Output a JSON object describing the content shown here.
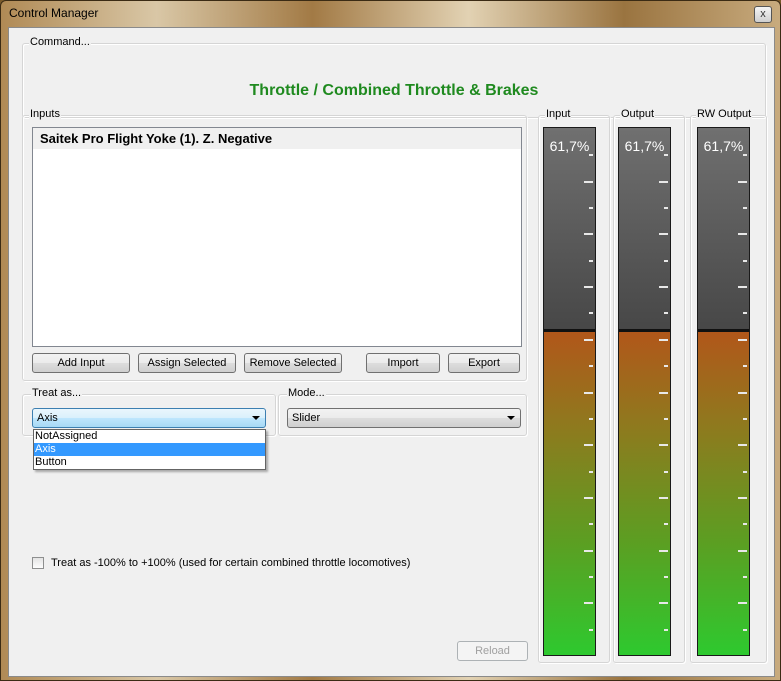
{
  "window": {
    "title": "Control Manager",
    "close_glyph": "x"
  },
  "command": {
    "label": "Command...",
    "text": "Throttle / Combined Throttle & Brakes"
  },
  "inputs": {
    "label": "Inputs",
    "items": [
      "Saitek Pro Flight Yoke (1). Z. Negative"
    ]
  },
  "buttons": {
    "add_input": "Add Input",
    "assign_selected": "Assign Selected",
    "remove_selected": "Remove Selected",
    "import": "Import",
    "export": "Export",
    "reload": "Reload"
  },
  "treat_as": {
    "label": "Treat as...",
    "value": "Axis",
    "options": [
      "NotAssigned",
      "Axis",
      "Button"
    ],
    "selected_index": 1
  },
  "mode": {
    "label": "Mode...",
    "value": "Slider"
  },
  "checkbox": {
    "label": "Treat as -100% to +100% (used for certain combined throttle locomotives)",
    "checked": false
  },
  "meters": [
    {
      "label": "Input",
      "value_text": "61,7%",
      "level": 0.617
    },
    {
      "label": "Output",
      "value_text": "61,7%",
      "level": 0.617
    },
    {
      "label": "RW Output",
      "value_text": "61,7%",
      "level": 0.617
    }
  ],
  "colors": {
    "command_text": "#1f8a1f",
    "selection": "#3399ff",
    "meter_low": "#2ec92f",
    "meter_high": "#b2561a",
    "meter_empty": "#5a5a5a"
  },
  "icons": {
    "close": "close-icon",
    "dropdown": "chevron-down-icon"
  }
}
